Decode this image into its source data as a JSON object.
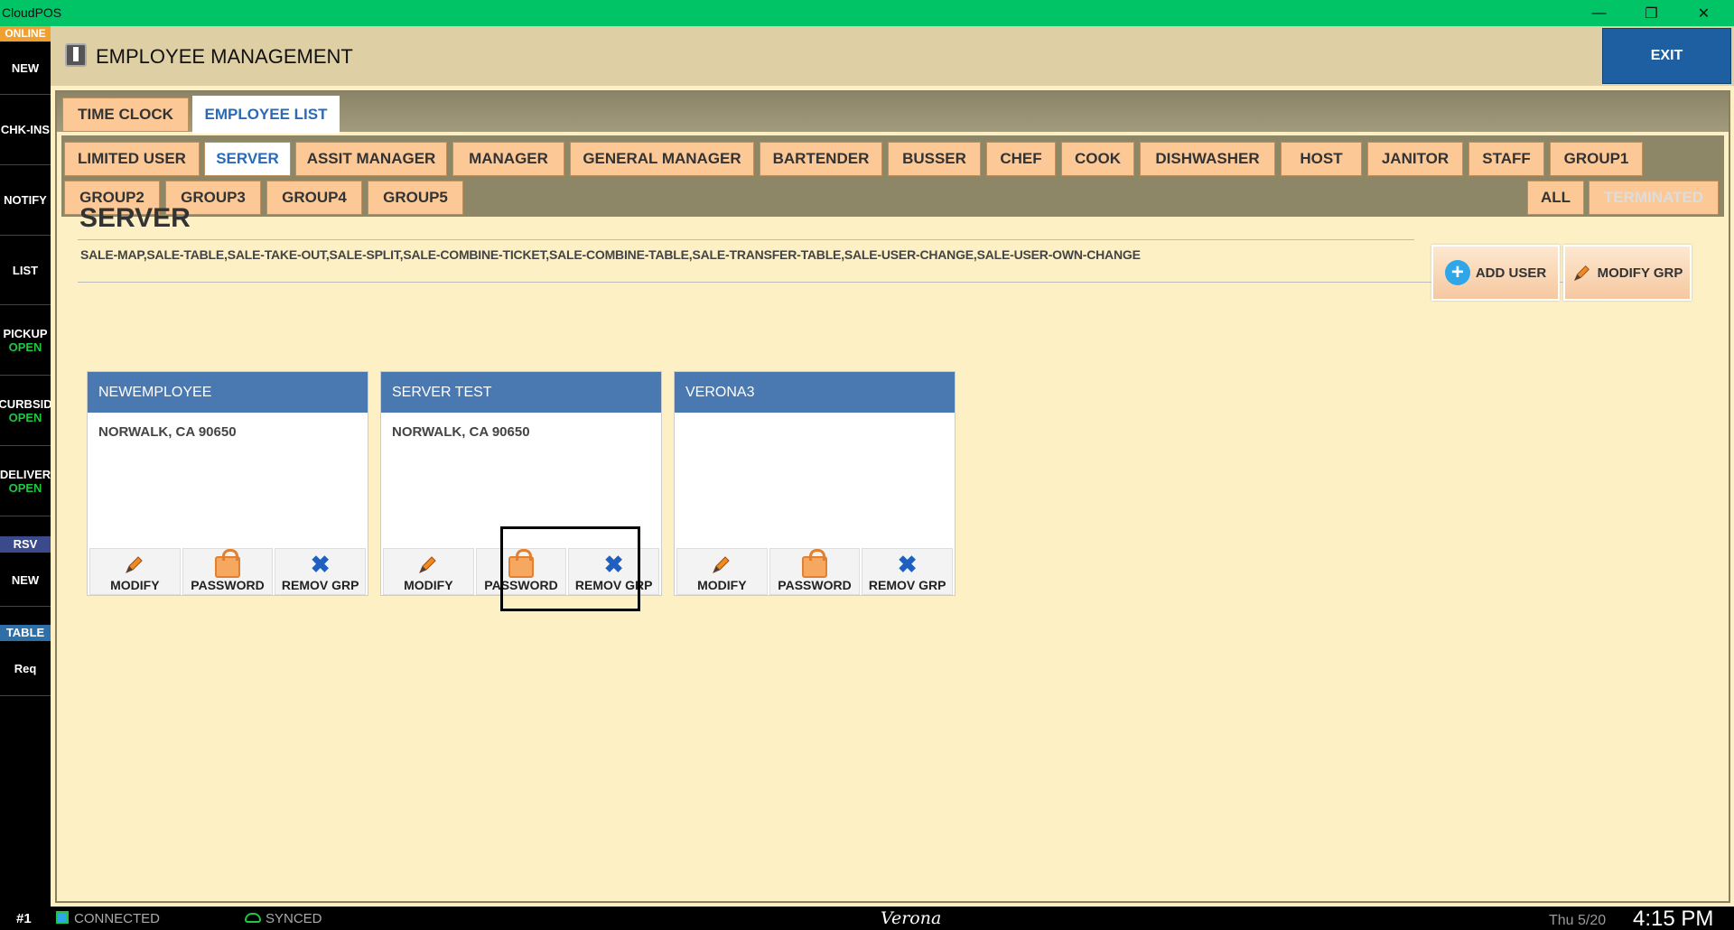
{
  "window": {
    "title": "CloudPOS",
    "controls": [
      "minimize-icon",
      "restore-icon",
      "close-icon"
    ]
  },
  "sidebar": {
    "status": "ONLINE",
    "items": [
      {
        "label": "NEW",
        "sub": ""
      },
      {
        "label": "CHK-INS",
        "sub": ""
      },
      {
        "label": "NOTIFY",
        "sub": ""
      },
      {
        "label": "LIST",
        "sub": ""
      },
      {
        "label": "PICKUP",
        "sub": "OPEN"
      },
      {
        "label": "CURBSID",
        "sub": "OPEN"
      },
      {
        "label": "DELIVER",
        "sub": "OPEN"
      }
    ],
    "rsv_header": "RSV",
    "rsv_new": "NEW",
    "table_header": "TABLE",
    "req": "Req"
  },
  "header": {
    "title": "EMPLOYEE MANAGEMENT",
    "exit_label": "EXIT"
  },
  "outer_tabs": [
    {
      "label": "TIME CLOCK",
      "active": false
    },
    {
      "label": "EMPLOYEE LIST",
      "active": true
    }
  ],
  "group_tabs_row1": [
    "LIMITED USER",
    "SERVER",
    "ASSIT MANAGER",
    "MANAGER",
    "GENERAL MANAGER",
    "BARTENDER",
    "BUSSER",
    "CHEF",
    "COOK",
    "DISHWASHER",
    "HOST",
    "JANITOR",
    "STAFF",
    "GROUP1"
  ],
  "group_tabs_row2": [
    "GROUP2",
    "GROUP3",
    "GROUP4",
    "GROUP5"
  ],
  "filter_tabs": {
    "all": "ALL",
    "terminated": "TERMINATED"
  },
  "active_group": "SERVER",
  "group": {
    "title": "SERVER",
    "permissions": "SALE-MAP,SALE-TABLE,SALE-TAKE-OUT,SALE-SPLIT,SALE-COMBINE-TICKET,SALE-COMBINE-TABLE,SALE-TRANSFER-TABLE,SALE-USER-CHANGE,SALE-USER-OWN-CHANGE",
    "add_user": "ADD USER",
    "modify_grp": "MODIFY GRP"
  },
  "employees": [
    {
      "name": "NEWEMPLOYEE",
      "address": "NORWALK, CA 90650"
    },
    {
      "name": "SERVER TEST",
      "address": "NORWALK, CA 90650"
    },
    {
      "name": "VERONA3",
      "address": ""
    }
  ],
  "card_actions": {
    "modify": "MODIFY",
    "password": "PASSWORD",
    "remove": "REMOV GRP"
  },
  "statusbar": {
    "terminal": "#1",
    "connection": "CONNECTED",
    "sync": "SYNCED",
    "store": "Verona",
    "date": "Thu 5/20",
    "time": "4:15 PM"
  },
  "colors": {
    "titlebar": "#00c466",
    "accent": "#1d5fa0",
    "tab": "#fcc896",
    "card_header": "#4a78b0"
  }
}
